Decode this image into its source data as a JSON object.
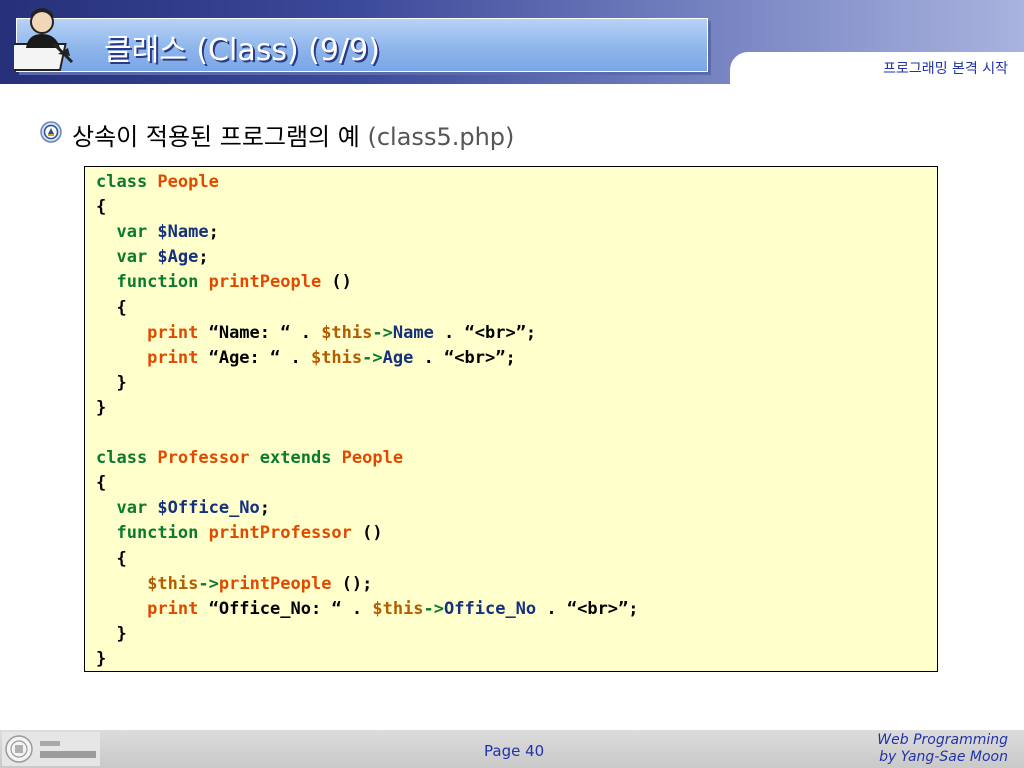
{
  "header": {
    "title": "클래스 (Class) (9/9)",
    "subtitle": "프로그래밍 본격 시작"
  },
  "bullet": {
    "text": "상속이 적용된 프로그램의 예",
    "file": "(class5.php)"
  },
  "code": {
    "lines": [
      [
        {
          "t": "class ",
          "c": "kw"
        },
        {
          "t": "People",
          "c": "nm"
        }
      ],
      [
        {
          "t": "{",
          "c": ""
        }
      ],
      [
        {
          "t": "  var ",
          "c": "kw"
        },
        {
          "t": "$Name",
          "c": "vr"
        },
        {
          "t": ";",
          "c": ""
        }
      ],
      [
        {
          "t": "  var ",
          "c": "kw"
        },
        {
          "t": "$Age",
          "c": "vr"
        },
        {
          "t": ";",
          "c": ""
        }
      ],
      [
        {
          "t": "  function ",
          "c": "kw"
        },
        {
          "t": "printPeople",
          "c": "nm"
        },
        {
          "t": " ()",
          "c": ""
        }
      ],
      [
        {
          "t": "  {",
          "c": ""
        }
      ],
      [
        {
          "t": "     print ",
          "c": "nm"
        },
        {
          "t": "“Name: “ . ",
          "c": ""
        },
        {
          "t": "$this",
          "c": "thisv"
        },
        {
          "t": "->",
          "c": "kw"
        },
        {
          "t": "Name",
          "c": "vr"
        },
        {
          "t": " . “<br>”;",
          "c": ""
        }
      ],
      [
        {
          "t": "     print ",
          "c": "nm"
        },
        {
          "t": "“Age: “ . ",
          "c": ""
        },
        {
          "t": "$this",
          "c": "thisv"
        },
        {
          "t": "->",
          "c": "kw"
        },
        {
          "t": "Age",
          "c": "vr"
        },
        {
          "t": " . “<br>”;",
          "c": ""
        }
      ],
      [
        {
          "t": "  }",
          "c": ""
        }
      ],
      [
        {
          "t": "}",
          "c": ""
        }
      ],
      [],
      [
        {
          "t": "class ",
          "c": "kw"
        },
        {
          "t": "Professor",
          "c": "nm"
        },
        {
          "t": " extends ",
          "c": "kw"
        },
        {
          "t": "People",
          "c": "nm"
        }
      ],
      [
        {
          "t": "{",
          "c": ""
        }
      ],
      [
        {
          "t": "  var ",
          "c": "kw"
        },
        {
          "t": "$Office_No",
          "c": "vr"
        },
        {
          "t": ";",
          "c": ""
        }
      ],
      [
        {
          "t": "  function ",
          "c": "kw"
        },
        {
          "t": "printProfessor",
          "c": "nm"
        },
        {
          "t": " ()",
          "c": ""
        }
      ],
      [
        {
          "t": "  {",
          "c": ""
        }
      ],
      [
        {
          "t": "     ",
          "c": ""
        },
        {
          "t": "$this",
          "c": "thisv"
        },
        {
          "t": "->",
          "c": "kw"
        },
        {
          "t": "printPeople",
          "c": "nm"
        },
        {
          "t": " ();",
          "c": ""
        }
      ],
      [
        {
          "t": "     print ",
          "c": "nm"
        },
        {
          "t": "“Office_No: “ . ",
          "c": ""
        },
        {
          "t": "$this",
          "c": "thisv"
        },
        {
          "t": "->",
          "c": "kw"
        },
        {
          "t": "Office_No",
          "c": "vr"
        },
        {
          "t": " . “<br>”;",
          "c": ""
        }
      ],
      [
        {
          "t": "  }",
          "c": ""
        }
      ],
      [
        {
          "t": "}",
          "c": ""
        }
      ]
    ]
  },
  "footer": {
    "page": "Page 40",
    "credit_line1": "Web Programming",
    "credit_line2": "by Yang-Sae Moon",
    "logo_icon": "university-seal-icon"
  },
  "colors": {
    "keyword": "#0b7a2f",
    "name": "#e04a00",
    "variable": "#15307d",
    "code_bg": "#ffffcc",
    "accent": "#2233aa"
  }
}
